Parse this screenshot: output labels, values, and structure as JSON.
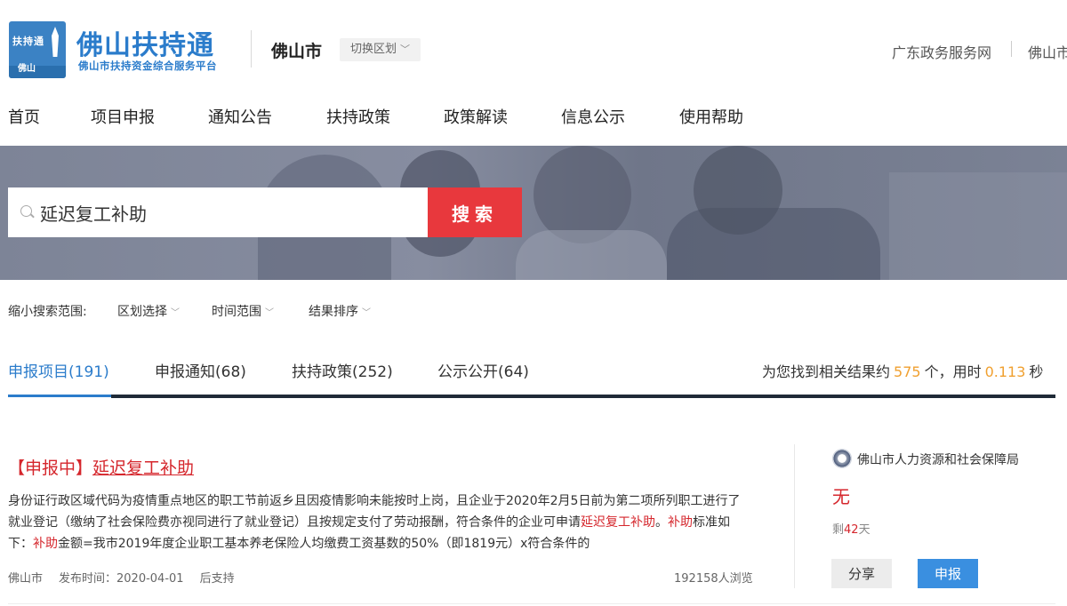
{
  "header": {
    "logo_top": "扶持通",
    "logo_bottom": "佛山",
    "brand_title": "佛山扶持通",
    "brand_subtitle": "佛山市扶持资金综合服务平台",
    "city": "佛山市",
    "switch_region": "切换区划",
    "links": [
      "广东政务服务网",
      "佛山市"
    ]
  },
  "nav": {
    "items": [
      "首页",
      "项目申报",
      "通知公告",
      "扶持政策",
      "政策解读",
      "信息公示",
      "使用帮助"
    ]
  },
  "search": {
    "value": "延迟复工补助",
    "button": "搜索"
  },
  "filters": {
    "label": "缩小搜索范围:",
    "items": [
      "区划选择",
      "时间范围",
      "结果排序"
    ]
  },
  "tabs": [
    {
      "label": "申报项目(191)"
    },
    {
      "label": "申报通知(68)"
    },
    {
      "label": "扶持政策(252)"
    },
    {
      "label": "公示公开(64)"
    }
  ],
  "results_summary": {
    "prefix": "为您找到相关结果约",
    "count": "575",
    "mid": "个，用时",
    "time": "0.113",
    "suffix": "秒"
  },
  "result": {
    "status": "【申报中】",
    "title": "延迟复工补助",
    "desc_part1": "身份证行政区域代码为疫情重点地区的职工节前返乡且因疫情影响未能按时上岗，且企业于2020年2月5日前为第二项所列职工进行了就业登记（缴纳了社会保险费亦视同进行了就业登记）且按规定支付了劳动报酬，符合条件的企业可申请",
    "desc_hl1": "延迟复工补助",
    "desc_part2": "。",
    "desc_hl2": "补助",
    "desc_part3": "标准如下：",
    "desc_hl3": "补助",
    "desc_part4": "金额=我市2019年度企业职工基本养老保险人均缴费工资基数的50%（即1819元）x符合条件的",
    "region": "佛山市",
    "publish_time": "发布时间：2020-04-01",
    "support": "后支持",
    "views": "192158人浏览",
    "department": "佛山市人力资源和社会保障局",
    "amount": "无",
    "remaining_prefix": "剩",
    "remaining_days": "42",
    "remaining_suffix": "天",
    "share": "分享",
    "apply": "申报"
  },
  "colors": {
    "brand_blue": "#2b7ccb",
    "search_red": "#e8383d",
    "highlight_red": "#d5262c",
    "number_orange": "#f0a030"
  }
}
